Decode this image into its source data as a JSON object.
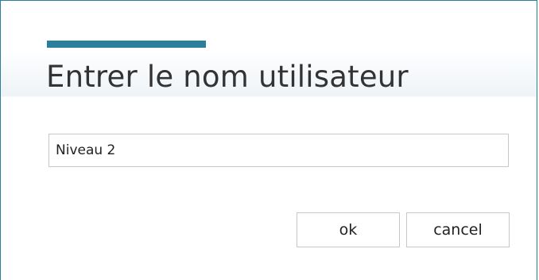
{
  "dialog": {
    "title": "Entrer le nom utilisateur",
    "input": {
      "value": "Niveau 2",
      "placeholder": ""
    },
    "buttons": {
      "ok_label": "ok",
      "cancel_label": "cancel"
    },
    "colors": {
      "accent": "#2a7f9a",
      "text": "#333333",
      "border": "#c8c8c8"
    }
  }
}
